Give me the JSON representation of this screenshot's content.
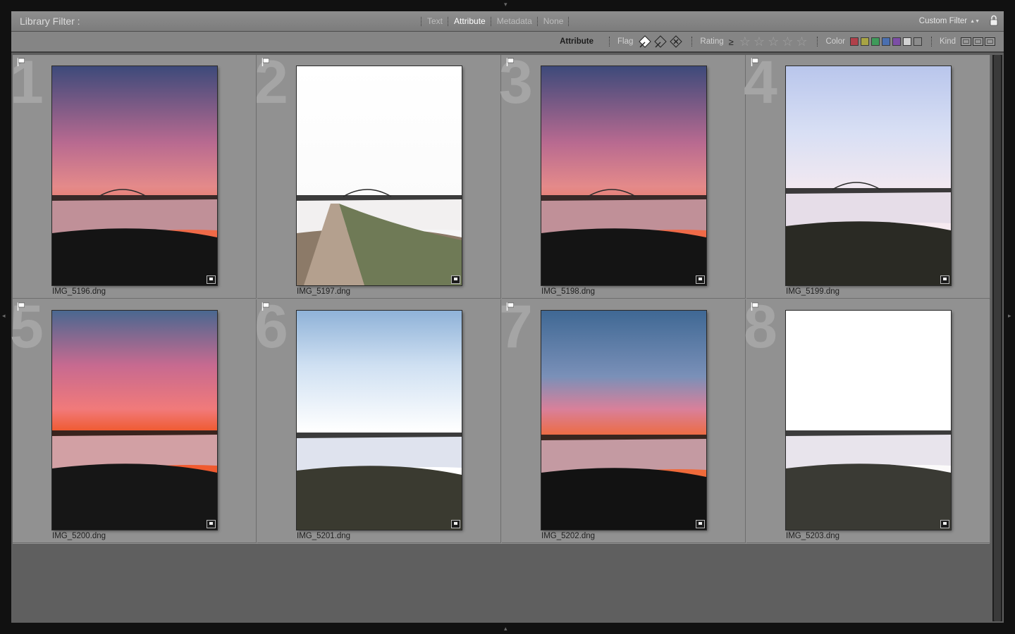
{
  "filter_bar": {
    "title": "Library Filter :",
    "tabs": [
      {
        "label": "Text",
        "active": false
      },
      {
        "label": "Attribute",
        "active": true
      },
      {
        "label": "Metadata",
        "active": false
      },
      {
        "label": "None",
        "active": false
      }
    ],
    "custom_filter": "Custom Filter"
  },
  "attribute_bar": {
    "title": "Attribute",
    "flag_label": "Flag",
    "rating_label": "Rating",
    "rating_operator": "≥",
    "stars": [
      "☆",
      "☆",
      "☆",
      "☆",
      "☆"
    ],
    "color_label": "Color",
    "colors": [
      "#b0404a",
      "#a8a444",
      "#3f9a5a",
      "#4a6fb0",
      "#7c4ea6",
      "#d2d2d2",
      "#8c8c8c"
    ],
    "kind_label": "Kind"
  },
  "grid": {
    "items": [
      {
        "index": "1",
        "filename": "IMG_5196.dng",
        "scene": "sunset-bridge-dark",
        "flagged": true
      },
      {
        "index": "2",
        "filename": "IMG_5197.dng",
        "scene": "overexposed-path",
        "flagged": true
      },
      {
        "index": "3",
        "filename": "IMG_5198.dng",
        "scene": "sunset-bridge-dark",
        "flagged": true
      },
      {
        "index": "4",
        "filename": "IMG_5199.dng",
        "scene": "bright-river-bridge",
        "flagged": true
      },
      {
        "index": "5",
        "filename": "IMG_5200.dng",
        "scene": "sunset-river",
        "flagged": true
      },
      {
        "index": "6",
        "filename": "IMG_5201.dng",
        "scene": "bright-river",
        "flagged": true
      },
      {
        "index": "7",
        "filename": "IMG_5202.dng",
        "scene": "sunset-river-blue",
        "flagged": true
      },
      {
        "index": "8",
        "filename": "IMG_5203.dng",
        "scene": "white-sky-river",
        "flagged": true
      }
    ]
  }
}
